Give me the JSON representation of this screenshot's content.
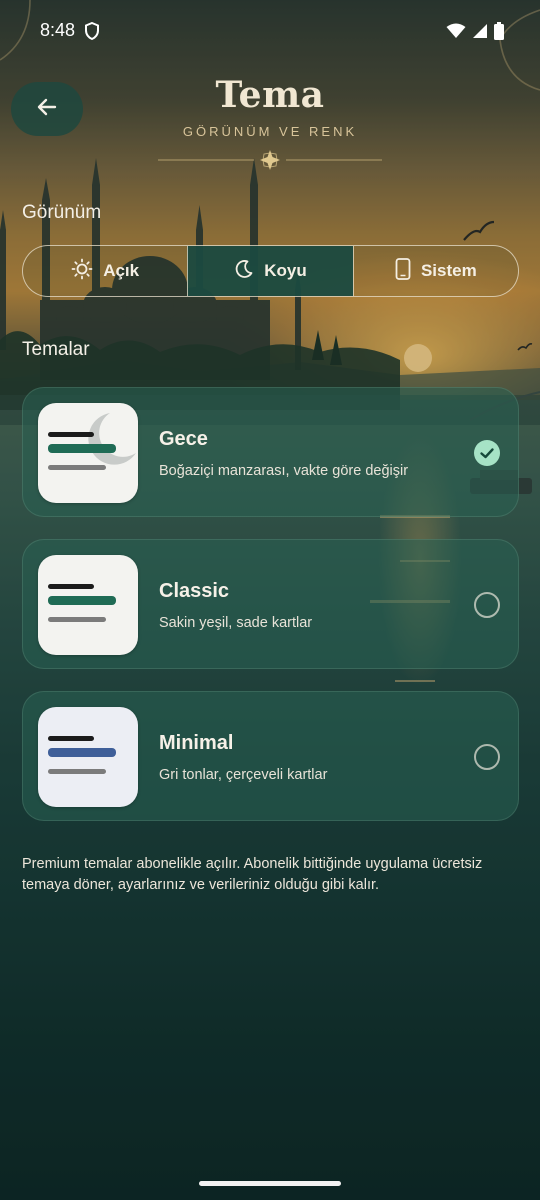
{
  "status_bar": {
    "time": "8:48"
  },
  "header": {
    "title": "Tema",
    "subtitle": "GÖRÜNÜM VE RENK"
  },
  "appearance": {
    "label": "Görünüm",
    "options": [
      {
        "label": "Açık",
        "icon": "sun-icon",
        "selected": false
      },
      {
        "label": "Koyu",
        "icon": "moon-icon",
        "selected": true
      },
      {
        "label": "Sistem",
        "icon": "phone-icon",
        "selected": false
      }
    ]
  },
  "themes": {
    "label": "Temalar",
    "items": [
      {
        "title": "Gece",
        "description": "Boğaziçi manzarası, vakte göre değişir",
        "selected": true
      },
      {
        "title": "Classic",
        "description": "Sakin yeşil, sade kartlar",
        "selected": false
      },
      {
        "title": "Minimal",
        "description": "Gri tonlar, çerçeveli kartlar",
        "selected": false
      }
    ]
  },
  "footnote": "Premium temalar abonelikle açılır. Abonelik bittiğinde uygulama ücretsiz temaya döner, ayarlarınız ve verileriniz olduğu gibi kalır.",
  "colors": {
    "accent_green": "#1f6b55",
    "selected_check": "#a6e3c6",
    "title_cream": "#f1e7d2",
    "subtitle_gold": "#d8c49a",
    "minimal_blue": "#3f5f99"
  }
}
